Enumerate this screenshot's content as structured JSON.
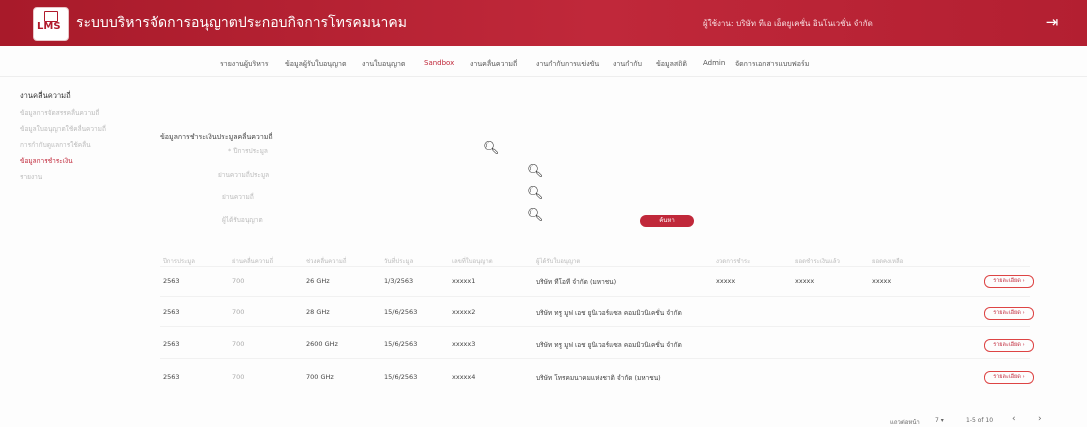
{
  "header": {
    "logo_text": "LMS",
    "title": "ระบบบริหารจัดการอนุญาตประกอบกิจการโทรคมนาคม",
    "user": "ผู้ใช้งาน: บริษัท ทีเอ เอ็ดยูเคชั่น อินโนเวชั่น จำกัด",
    "logout_icon": "logout-icon"
  },
  "nav": [
    {
      "label": "รายงานผู้บริหาร",
      "active": false
    },
    {
      "label": "ข้อมูลผู้รับใบอนุญาต",
      "active": false
    },
    {
      "label": "งานใบอนุญาต",
      "active": false
    },
    {
      "label": "Sandbox",
      "active": true
    },
    {
      "label": "งานคลื่นความถี่",
      "active": false
    },
    {
      "label": "งานกำกับการแข่งขัน",
      "active": false
    },
    {
      "label": "งานกำกับ",
      "active": false
    },
    {
      "label": "ข้อมูลสถิติ",
      "active": false
    },
    {
      "label": "Admin",
      "active": false
    },
    {
      "label": "จัดการเอกสารแบบฟอร์ม",
      "active": false
    }
  ],
  "sidebar": {
    "title": "งานคลื่นความถี่",
    "items": [
      {
        "label": "ข้อมูลการจัดสรรคลื่นความถี่",
        "active": false
      },
      {
        "label": "ข้อมูลใบอนุญาตใช้คลื่นความถี่",
        "active": false
      },
      {
        "label": "การกำกับดูแลการใช้คลื่น",
        "active": false
      },
      {
        "label": "ข้อมูลการชำระเงิน",
        "active": true
      },
      {
        "label": "รายงาน",
        "active": false
      }
    ]
  },
  "main": {
    "section_title": "ข้อมูลการชำระเงินประมูลคลื่นความถี่",
    "form": {
      "fields": [
        {
          "label": "* ปีการประมูล"
        },
        {
          "label": "ย่านความถี่ประมูล"
        },
        {
          "label": "ย่านความถี่"
        },
        {
          "label": "ผู้ได้รับอนุญาต"
        }
      ],
      "submit_label": "ค้นหา"
    },
    "table": {
      "headers": [
        "ปีการประมูล",
        "ย่านคลื่นความถี่",
        "ช่วงคลื่นความถี่",
        "วันที่ประมูล",
        "เลขที่ใบอนุญาต",
        "ผู้ได้รับใบอนุญาต",
        "งวดการชำระ",
        "ยอดชำระเงินแล้ว",
        "ยอดคงเหลือ"
      ],
      "rows": [
        {
          "year": "2563",
          "band": "700",
          "range": "26 GHz",
          "date": "1/3/2563",
          "license": "xxxxx1",
          "licensee": "บริษัท ทีโอที จำกัด (มหาชน)",
          "installment": "xxxxx",
          "paid": "xxxxx",
          "balance": "xxxxx",
          "action": "รายละเอียด"
        },
        {
          "year": "2563",
          "band": "700",
          "range": "28 GHz",
          "date": "15/6/2563",
          "license": "xxxxx2",
          "licensee": "บริษัท ทรู มูฟ เอช ยูนิเวอร์แซล คอมมิวนิเคชั่น จำกัด",
          "installment": "",
          "paid": "",
          "balance": "",
          "action": "รายละเอียด"
        },
        {
          "year": "2563",
          "band": "700",
          "range": "2600 GHz",
          "date": "15/6/2563",
          "license": "xxxxx3",
          "licensee": "บริษัท ทรู มูฟ เอช ยูนิเวอร์แซล คอมมิวนิเคชั่น จำกัด",
          "installment": "",
          "paid": "",
          "balance": "",
          "action": "รายละเอียด"
        },
        {
          "year": "2563",
          "band": "700",
          "range": "700 GHz",
          "date": "15/6/2563",
          "license": "xxxxx4",
          "licensee": "บริษัท โทรคมนาคมแห่งชาติ จำกัด (มหาชน)",
          "installment": "",
          "paid": "",
          "balance": "",
          "action": "รายละเอียด"
        }
      ]
    },
    "pagination": {
      "rows_label": "แถวต่อหน้า",
      "rows_value": "7",
      "range": "1-5 of 10",
      "prev": "‹",
      "next": "›"
    }
  }
}
